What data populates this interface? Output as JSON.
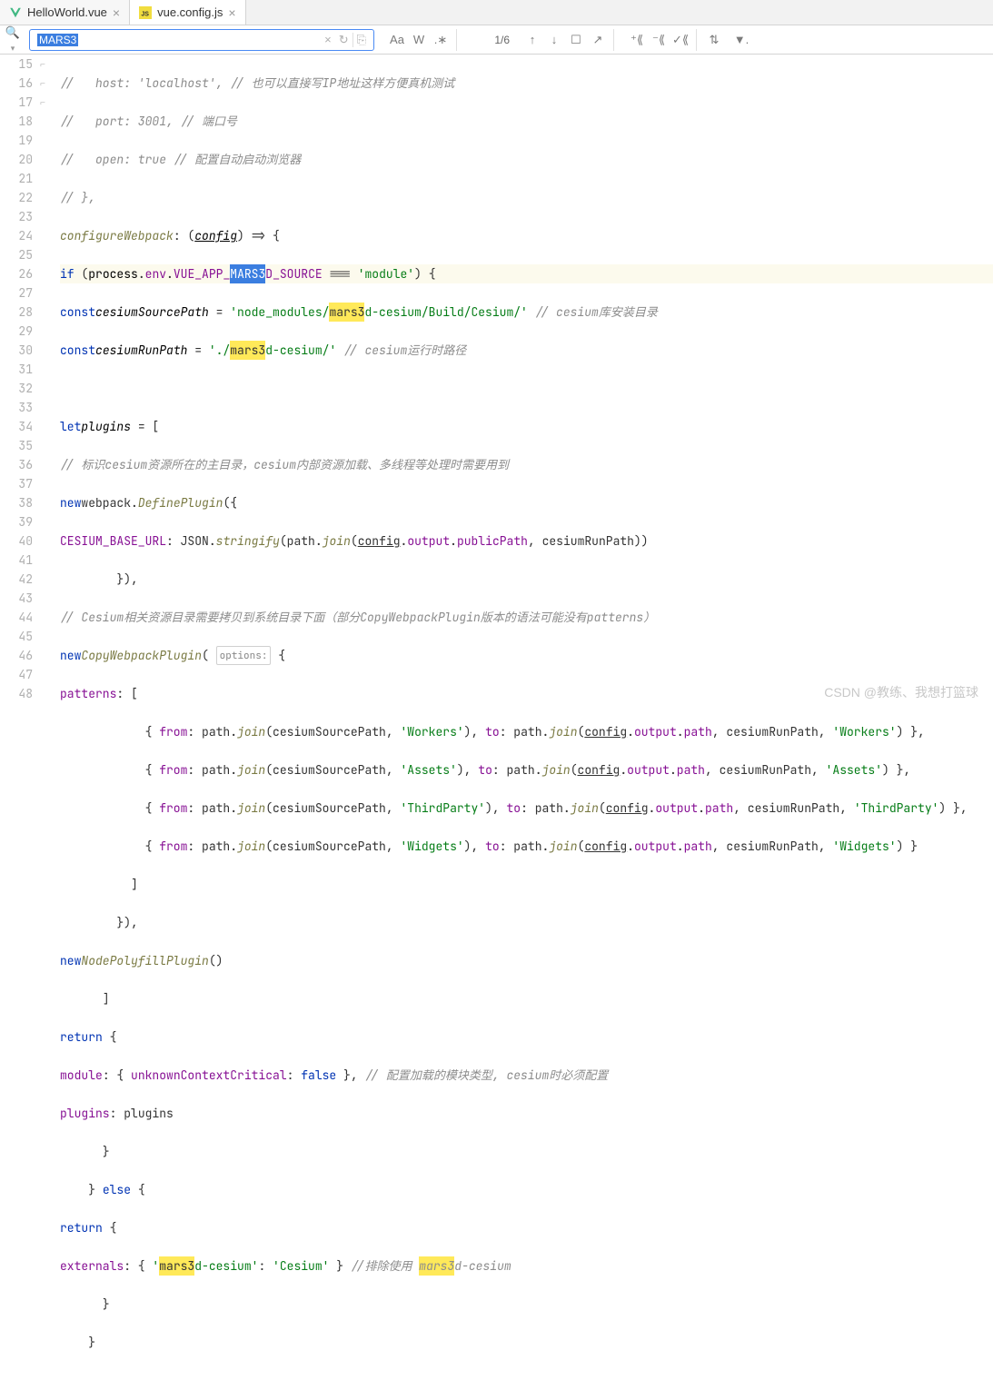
{
  "tabs": [
    {
      "label": "HelloWorld.vue",
      "active": false
    },
    {
      "label": "vue.config.js",
      "active": true
    }
  ],
  "find": {
    "value": "MARS3",
    "count": "1/6"
  },
  "lines": {
    "ln15": "15",
    "ln16": "16",
    "ln17": "17",
    "ln18": "18",
    "ln19": "19",
    "ln20": "20",
    "ln21": "21",
    "ln22": "22",
    "ln23": "23",
    "ln24": "24",
    "ln25": "25",
    "ln26": "26",
    "ln27": "27",
    "ln28": "28",
    "ln29": "29",
    "ln30": "30",
    "ln31": "31",
    "ln32": "32",
    "ln33": "33",
    "ln34": "34",
    "ln35": "35",
    "ln36": "36",
    "ln37": "37",
    "ln38": "38",
    "ln39": "39",
    "ln40": "40",
    "ln41": "41",
    "ln42": "42",
    "ln43": "43",
    "ln44": "44",
    "ln45": "45",
    "ln46": "46",
    "ln47": "47",
    "ln48": "48"
  },
  "code": {
    "c15a": "//   host: 'localhost', // 也可以直接写IP地址这样方便真机测试",
    "c16a": "//   port: 3001, // 端口号",
    "c17a": "//   open: true // 配置自动启动浏览器",
    "c18a": "// },",
    "c19_configureWebpack": "configureWebpack",
    "c19_config": "config",
    "c20_if": "if",
    "c20_proc": "process",
    "c20_env": "env",
    "c20_appvar": "VUE_APP_",
    "c20_mars": "MARS3",
    "c20_source": "D_SOURCE",
    "c20_module": "'module'",
    "c21_const": "const",
    "c21_csp": "cesiumSourcePath",
    "c21_str1": "'node_modules/",
    "c21_mars": "mars3",
    "c21_str2": "d-cesium/Build/Cesium/'",
    "c21_cm": " // cesium库安装目录",
    "c22_const": "const",
    "c22_crp": "cesiumRunPath",
    "c22_str1": "'./",
    "c22_mars": "mars3",
    "c22_str2": "d-cesium/'",
    "c22_cm": " // cesium运行时路径",
    "c24_let": "let",
    "c24_plugins": "plugins",
    "c25_cm": "// 标识cesium资源所在的主目录，cesium内部资源加载、多线程等处理时需要用到",
    "c26_new": "new",
    "c26_wp": "webpack",
    "c26_dp": "DefinePlugin",
    "c27_cbu": "CESIUM_BASE_URL",
    "c27_json": "JSON",
    "c27_stringify": "stringify",
    "c27_path": "path",
    "c27_join": "join",
    "c27_config": "config",
    "c27_output": "output",
    "c27_pp": "publicPath",
    "c27_crp": "cesiumRunPath",
    "c29_cm": "// Cesium相关资源目录需要拷贝到系统目录下面（部分CopyWebpackPlugin版本的语法可能没有patterns）",
    "c30_new": "new",
    "c30_cwp": "CopyWebpackPlugin",
    "c30_opt": "options:",
    "c31_patterns": "patterns",
    "c32_from": "from",
    "c32_path": "path",
    "c32_join": "join",
    "c32_csp": "cesiumSourcePath",
    "c32_workers": "'Workers'",
    "c32_to": "to",
    "c32_config": "config",
    "c32_output": "output",
    "c32_opath": "path",
    "c32_crp": "cesiumRunPath",
    "c33_assets": "'Assets'",
    "c34_tp": "'ThirdParty'",
    "c35_widgets": "'Widgets'",
    "c38_new": "new",
    "c38_npp": "NodePolyfillPlugin",
    "c40_return": "return",
    "c41_module": "module",
    "c41_ucc": "unknownContextCritical",
    "c41_false": "false",
    "c41_cm": " // 配置加载的模块类型, cesium时必须配置",
    "c42_plugins": "plugins",
    "c42_plugins2": "plugins",
    "c44_else": "else",
    "c45_return": "return",
    "c46_ext": "externals",
    "c46_str1": "'",
    "c46_mars": "mars3",
    "c46_str2": "d-cesium'",
    "c46_cesium": "'Cesium'",
    "c46_cm1": " //排除使用 ",
    "c46_mars2": "mars3",
    "c46_cm2": "d-cesium"
  },
  "watermark": "CSDN @教练、我想打篮球"
}
